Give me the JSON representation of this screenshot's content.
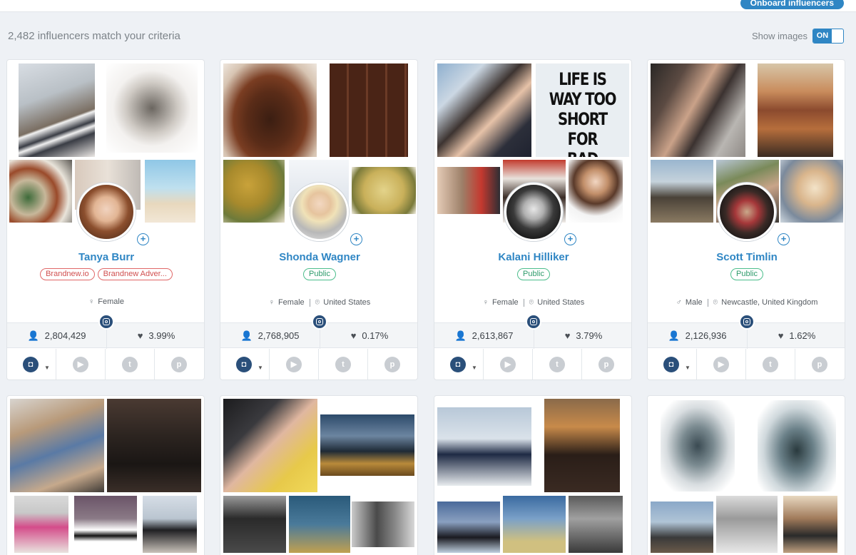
{
  "header": {
    "onboard_label": "Onboard influencers"
  },
  "results": {
    "count_text": "2,482 influencers match your criteria"
  },
  "show_images": {
    "label": "Show images",
    "toggle": "ON"
  },
  "colors": {
    "accent": "#2f86c4",
    "instagram": "#2a4f7a",
    "tag_red": "#e06767",
    "tag_green": "#4bbd8b"
  },
  "social_icons": [
    "instagram-icon",
    "youtube-icon",
    "twitter-icon",
    "pinterest-icon"
  ],
  "cards": [
    {
      "name": "Tanya Burr",
      "tags": [
        "Brandnew.io",
        "Brandnew Adver..."
      ],
      "tag_style": "red",
      "gender": "Female",
      "location": "",
      "followers": "2,804,429",
      "engagement": "3.99%"
    },
    {
      "name": "Shonda Wagner",
      "tags": [
        "Public"
      ],
      "tag_style": "green",
      "gender": "Female",
      "location": "United States",
      "followers": "2,768,905",
      "engagement": "0.17%"
    },
    {
      "name": "Kalani Hilliker",
      "tags": [
        "Public"
      ],
      "tag_style": "green",
      "gender": "Female",
      "location": "United States",
      "followers": "2,613,867",
      "engagement": "3.79%",
      "quote": [
        "LIFE IS",
        "WAY TOO",
        "SHORT FOR",
        "BAD VIBES."
      ]
    },
    {
      "name": "Scott Timlin",
      "tags": [
        "Public"
      ],
      "tag_style": "green",
      "gender": "Male",
      "location": "Newcastle, United Kingdom",
      "followers": "2,126,936",
      "engagement": "1.62%"
    }
  ]
}
